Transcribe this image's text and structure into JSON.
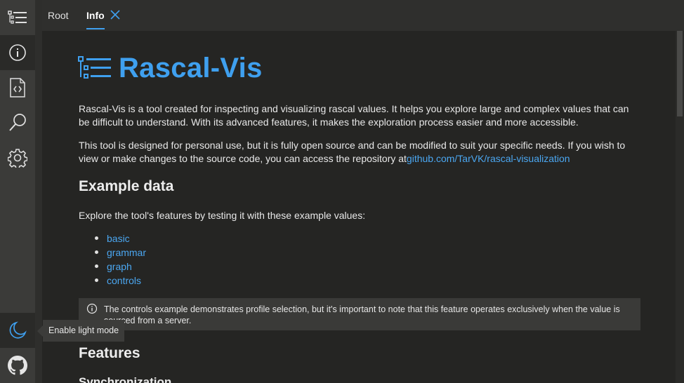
{
  "app": {
    "accent_color": "#3fa0ef",
    "background_color": "#252523"
  },
  "sidebar": {
    "items": [
      {
        "icon": "tree-list-icon",
        "active": false
      },
      {
        "icon": "info-icon",
        "active": true
      },
      {
        "icon": "code-file-icon",
        "active": false
      },
      {
        "icon": "search-icon",
        "active": false
      },
      {
        "icon": "gear-icon",
        "active": false
      }
    ],
    "bottom_items": [
      {
        "icon": "moon-icon"
      },
      {
        "icon": "github-icon"
      }
    ]
  },
  "tabs": [
    {
      "label": "Root",
      "active": false
    },
    {
      "label": "Info",
      "active": true,
      "closable": true
    }
  ],
  "tooltip": {
    "text": "Enable light mode"
  },
  "page": {
    "title": "Rascal-Vis",
    "intro": "Rascal-Vis is a tool created for inspecting and visualizing rascal values. It helps you explore large and complex values that can be difficult to understand. With its advanced features, it makes the exploration process easier and more accessible.",
    "source_text": "This tool is designed for personal use, but it is fully open source and can be modified to suit your specific needs. If you wish to view or make changes to the source code, you can access the repository at",
    "repo_link": "github.com/TarVK/rascal-visualization",
    "example_heading": "Example data",
    "example_intro": "Explore the tool's features by testing it with these example values:",
    "examples": [
      "basic",
      "grammar",
      "graph",
      "controls"
    ],
    "note": "The controls example demonstrates profile selection, but it's important to note that this feature operates exclusively when the value is sourced from a server.",
    "features_heading": "Features",
    "sync_heading": "Synchronization"
  }
}
